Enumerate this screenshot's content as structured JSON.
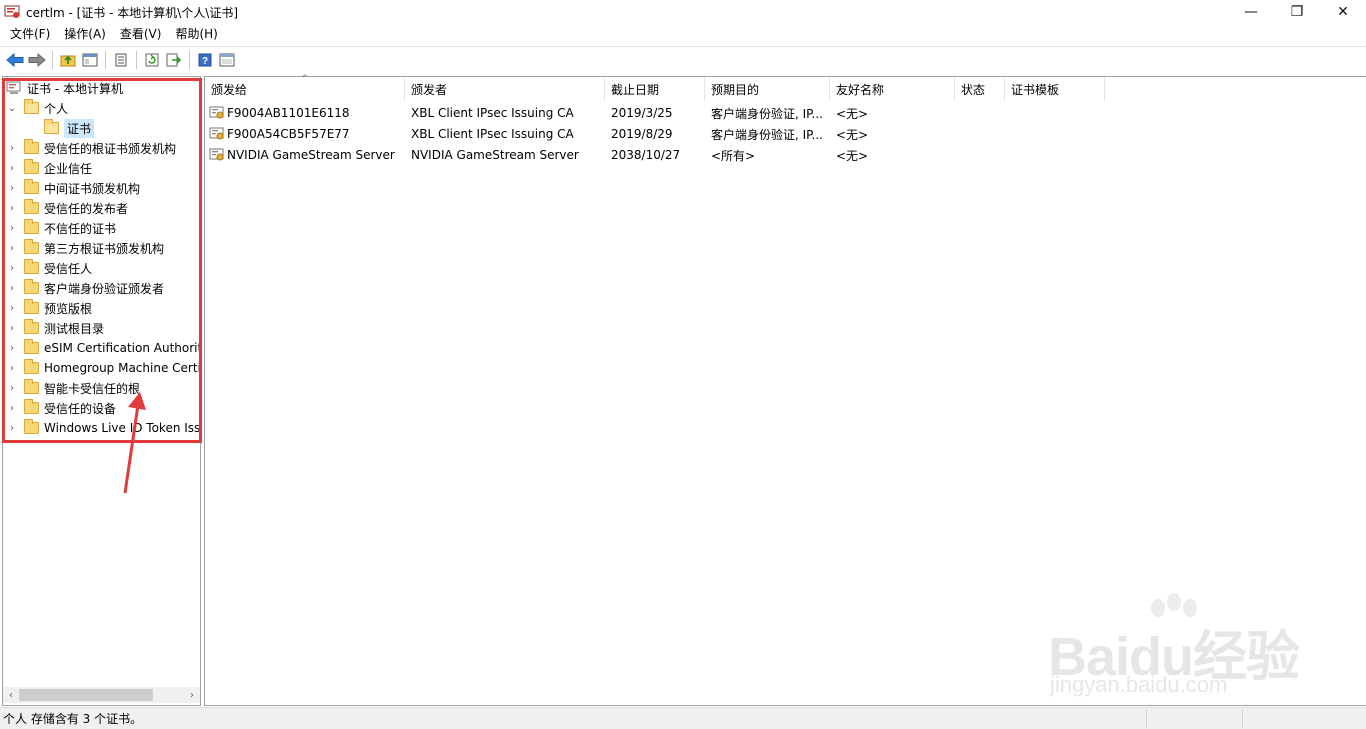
{
  "window": {
    "title": "certlm - [证书 - 本地计算机\\个人\\证书]",
    "controls": {
      "minimize": "—",
      "restore": "❐",
      "close": "✕"
    }
  },
  "menu": [
    "文件(F)",
    "操作(A)",
    "查看(V)",
    "帮助(H)"
  ],
  "toolbar": [
    "back-icon",
    "forward-icon",
    "up-folder-icon",
    "show-tree-icon",
    "properties-icon",
    "refresh-icon",
    "export-icon",
    "help-icon",
    "mmc-icon"
  ],
  "tree": {
    "root": "证书 - 本地计算机",
    "personal": "个人",
    "personal_certs": "证书",
    "folders": [
      "受信任的根证书颁发机构",
      "企业信任",
      "中间证书颁发机构",
      "受信任的发布者",
      "不信任的证书",
      "第三方根证书颁发机构",
      "受信任人",
      "客户端身份验证颁发者",
      "预览版根",
      "测试根目录",
      "eSIM Certification Authorities",
      "Homegroup Machine Certificates",
      "智能卡受信任的根",
      "受信任的设备",
      "Windows Live ID Token Issuer"
    ]
  },
  "columns": [
    "颁发给",
    "颁发者",
    "截止日期",
    "预期目的",
    "友好名称",
    "状态",
    "证书模板"
  ],
  "rows": [
    {
      "issued_to": "F9004AB1101E6118",
      "issued_by": "XBL Client IPsec Issuing CA",
      "expires": "2019/3/25",
      "purpose": "客户端身份验证, IP...",
      "friendly": "<无>"
    },
    {
      "issued_to": "F900A54CB5F57E77",
      "issued_by": "XBL Client IPsec Issuing CA",
      "expires": "2019/8/29",
      "purpose": "客户端身份验证, IP...",
      "friendly": "<无>"
    },
    {
      "issued_to": "NVIDIA GameStream Server",
      "issued_by": "NVIDIA GameStream Server",
      "expires": "2038/10/27",
      "purpose": "<所有>",
      "friendly": "<无>"
    }
  ],
  "status": "个人 存储含有 3 个证书。",
  "watermark": {
    "brand": "Baidu经验",
    "url": "jingyan.baidu.com"
  },
  "colors": {
    "annotation": "#e23b3b",
    "selection": "#cce8ff",
    "folder": "#f7d675"
  }
}
